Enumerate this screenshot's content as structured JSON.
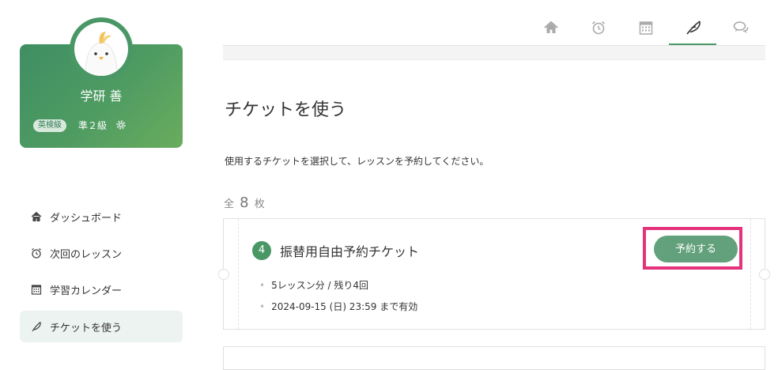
{
  "profile": {
    "name": "学研 善",
    "badge": "英検級",
    "grade": "準２級"
  },
  "sidebar": {
    "items": [
      {
        "label": "ダッシュボード",
        "icon": "home-icon"
      },
      {
        "label": "次回のレッスン",
        "icon": "alarm-clock-icon"
      },
      {
        "label": "学習カレンダー",
        "icon": "calendar-icon"
      },
      {
        "label": "チケットを使う",
        "icon": "feather-icon",
        "active": true
      }
    ]
  },
  "topnav": {
    "icons": [
      "home-icon",
      "alarm-clock-icon",
      "calendar-icon",
      "feather-icon",
      "chat-bubbles-icon"
    ],
    "active_index": 3
  },
  "main": {
    "title": "チケットを使う",
    "description": "使用するチケットを選択して、レッスンを予約してください。",
    "count_prefix": "全",
    "count_value": "8",
    "count_suffix": "枚"
  },
  "ticket": {
    "number": "4",
    "title": "振替用自由予約チケット",
    "detail_1": "5レッスン分 / 残り4回",
    "detail_2": "2024-09-15 (日) 23:59 まで有効",
    "button_label": "予約する"
  },
  "colors": {
    "accent": "#4a9766",
    "button": "#63a17c",
    "highlight": "#e4337a"
  }
}
